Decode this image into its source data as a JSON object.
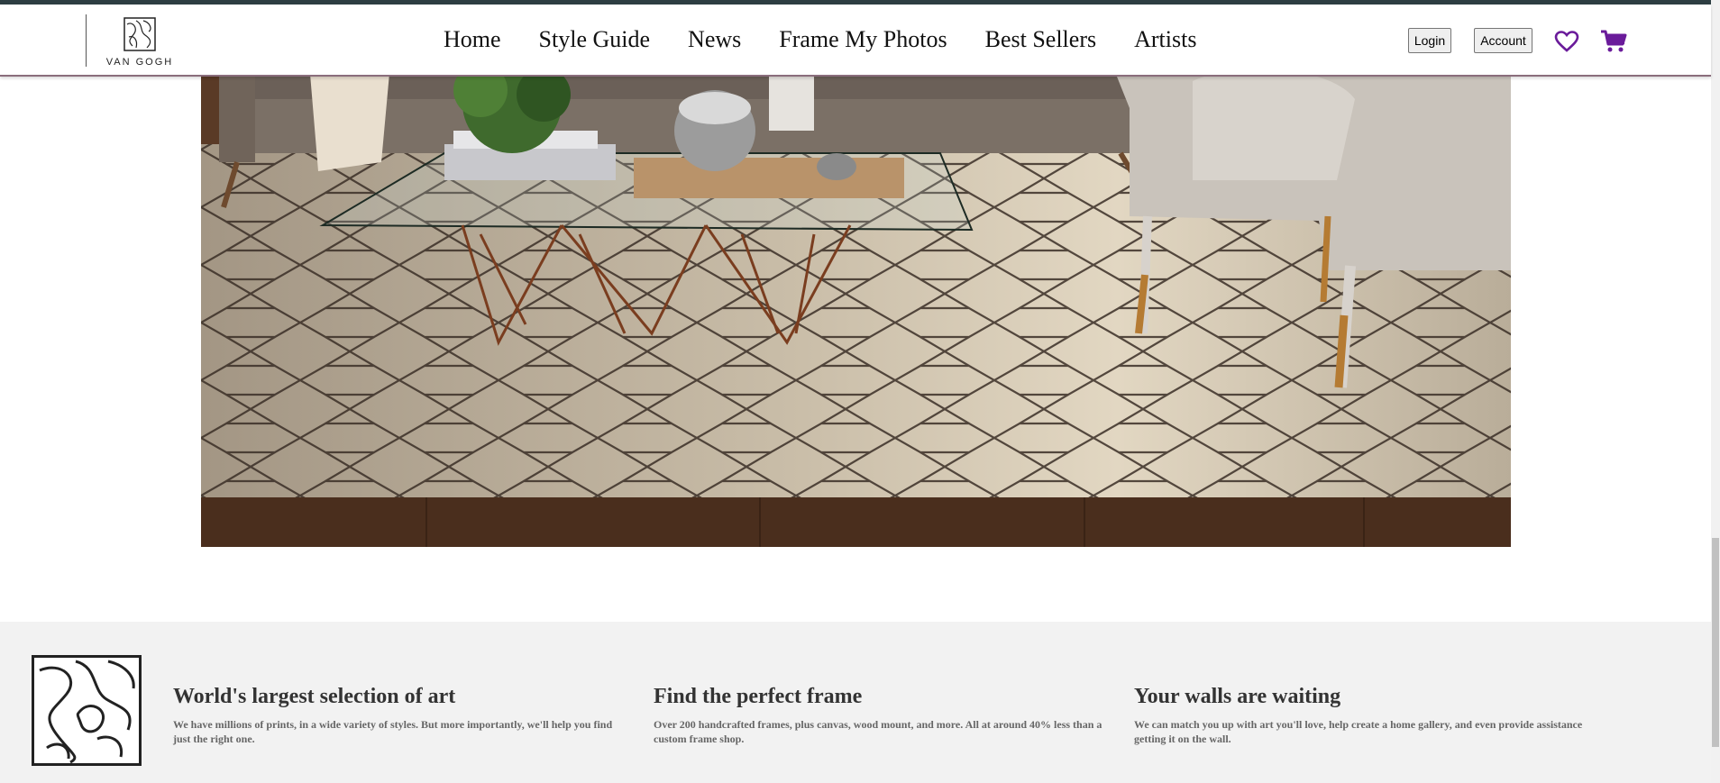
{
  "brand": {
    "name": "VAN GOGH"
  },
  "nav": {
    "items": [
      {
        "label": "Home"
      },
      {
        "label": "Style Guide"
      },
      {
        "label": "News"
      },
      {
        "label": "Frame My Photos"
      },
      {
        "label": "Best Sellers"
      },
      {
        "label": "Artists"
      }
    ]
  },
  "header_actions": {
    "login_label": "Login",
    "account_label": "Account",
    "wishlist_icon": "heart-icon",
    "cart_icon": "cart-icon",
    "accent_color": "#6a1b9a"
  },
  "features": [
    {
      "title": "World's largest selection of art",
      "text": "We have millions of prints, in a wide variety of styles. But more importantly, we'll help you find just the right one."
    },
    {
      "title": "Find the perfect frame",
      "text": "Over 200 handcrafted frames, plus canvas, wood mount, and more. All at around 40% less than a custom frame shop."
    },
    {
      "title": "Your walls are waiting",
      "text": "We can match you up with art you'll love, help create a home gallery, and even provide assistance getting it on the wall."
    }
  ]
}
